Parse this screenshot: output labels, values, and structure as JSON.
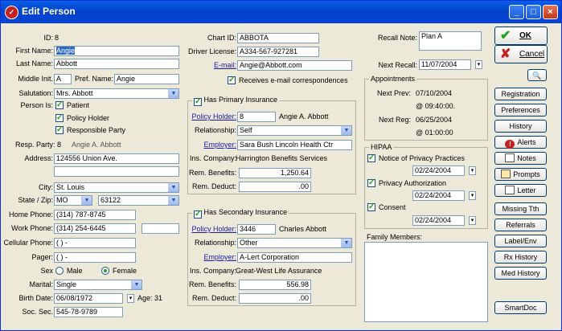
{
  "window": {
    "title": "Edit Person"
  },
  "person": {
    "id_label": "ID:",
    "id_value": "8",
    "first_name_label": "First Name:",
    "first_name": "Angie",
    "last_name_label": "Last Name:",
    "last_name": "Abbott",
    "middle_initial_label": "Middle Init.",
    "middle_initial": "A",
    "pref_name_label": "Pref. Name:",
    "pref_name": "Angie",
    "salutation_label": "Salutation:",
    "salutation": "Mrs. Abbott",
    "person_is_label": "Person Is:",
    "patient_label": "Patient",
    "policy_holder_label": "Policy Holder",
    "responsible_party_label": "Responsible Party",
    "resp_party_label": "Resp. Party: 8",
    "resp_party_name": "Angie A. Abbott",
    "address_label": "Address:",
    "address1": "124556 Union Ave.",
    "address2": "",
    "city_label": "City:",
    "city": "St. Louis",
    "state_zip_label": "State / Zip:",
    "state": "MO",
    "zip": "63122",
    "home_phone_label": "Home Phone:",
    "home_phone": "(314) 787-8745",
    "work_phone_label": "Work Phone:",
    "work_phone": "(314) 254-6445",
    "work_ext": "",
    "cell_phone_label": "Cellular Phone:",
    "cell_phone": "(   )    -",
    "pager_label": "Pager:",
    "pager": "(   )    -",
    "sex_label": "Sex",
    "male_label": "Male",
    "female_label": "Female",
    "marital_label": "Marital:",
    "marital": "Single",
    "birth_date_label": "Birth Date:",
    "birth_date": "06/08/1972",
    "age_text": "Age: 31",
    "ssn_label": "Soc. Sec.",
    "ssn": "545-78-9789"
  },
  "chart": {
    "chart_id_label": "Chart ID:",
    "chart_id": "ABBOTA",
    "license_label": "Driver License:",
    "license": "A334-567-927281",
    "email_label": "E-mail:",
    "email": "Angie@Abbott.com",
    "receives_email_label": "Receives e-mail correspondences"
  },
  "primary_insurance": {
    "title": "Has Primary Insurance",
    "policy_holder_label": "Policy Holder:",
    "policy_holder_id": "8",
    "policy_holder_name": "Angie A. Abbott",
    "relationship_label": "Relationship:",
    "relationship": "Self",
    "employer_label": "Employer:",
    "employer": "Sara Bush Lincoln Health Ctr",
    "company_label": "Ins. Company:",
    "company": "Harrington Benefits Services",
    "rem_benefits_label": "Rem. Benefits:",
    "rem_benefits": "1,250.64",
    "rem_deduct_label": "Rem. Deduct:",
    "rem_deduct": ".00"
  },
  "secondary_insurance": {
    "title": "Has Secondary Insurance",
    "policy_holder_label": "Policy Holder:",
    "policy_holder_id": "3446",
    "policy_holder_name": "Charles Abbott",
    "relationship_label": "Relationship:",
    "relationship": "Other",
    "employer_label": "Employer:",
    "employer": "A-Lert Corporation",
    "company_label": "Ins. Company:",
    "company": "Great-West Life Assurance",
    "rem_benefits_label": "Rem. Benefits:",
    "rem_benefits": "556.98",
    "rem_deduct_label": "Rem. Deduct:",
    "rem_deduct": ".00"
  },
  "recall": {
    "note_label": "Recall Note:",
    "note": "Plan A",
    "next_recall_label": "Next Recall:",
    "next_recall": "11/07/2004"
  },
  "appointments": {
    "title": "Appointments",
    "next_prev_label": "Next Prev:",
    "next_prev_date": "07/10/2004",
    "next_prev_time": "@ 09:40:00.",
    "next_reg_label": "Next Reg:",
    "next_reg_date": "06/25/2004",
    "next_reg_time": "@ 01:00:00"
  },
  "hipaa": {
    "title": "HIPAA",
    "notice_label": "Notice of Privacy Practices",
    "notice_date": "02/24/2004",
    "authorization_label": "Privacy Authorization",
    "authorization_date": "02/24/2004",
    "consent_label": "Consent",
    "consent_date": "02/24/2004"
  },
  "family": {
    "label": "Family Members:"
  },
  "buttons": {
    "ok": "OK",
    "cancel": "Cancel",
    "registration": "Registration",
    "preferences": "Preferences",
    "history": "History",
    "alerts": "Alerts",
    "notes": "Notes",
    "prompts": "Prompts",
    "letter": "Letter",
    "missing_tth": "Missing Tth",
    "referrals": "Referrals",
    "label_env": "Label/Env",
    "rx_history": "Rx History",
    "med_history": "Med History",
    "smartdoc": "SmartDoc"
  },
  "colors": {
    "title_bar": "#0a5fe7",
    "checkmark": "#21a121",
    "ok_check": "#21a121",
    "cancel_x": "#c62121",
    "highlight": "#316ac5"
  }
}
